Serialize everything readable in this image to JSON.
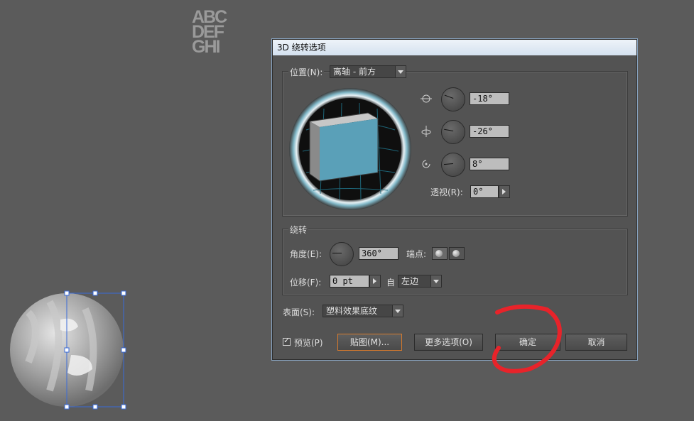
{
  "canvas": {
    "artwork_text_lines": [
      "ABC",
      "DEF",
      "GHI"
    ]
  },
  "dialog": {
    "title": "3D 绕转选项",
    "position": {
      "label": "位置(N):",
      "selected": "离轴 - 前方",
      "x_rotation": "-18°",
      "y_rotation": "-26°",
      "z_rotation": "8°",
      "perspective_label": "透视(R):",
      "perspective_value": "0°"
    },
    "revolve": {
      "section_label": "绕转",
      "angle_label": "角度(E):",
      "angle_value": "360°",
      "cap_label": "端点:",
      "offset_label": "位移(F):",
      "offset_value": "0 pt",
      "from_label": "自",
      "from_selected": "左边"
    },
    "surface": {
      "label": "表面(S):",
      "selected": "塑料效果底纹"
    },
    "buttons": {
      "preview_label": "预览(P)",
      "map_art": "贴图(M)...",
      "more_options": "更多选项(O)",
      "ok": "确定",
      "cancel": "取消"
    }
  },
  "colors": {
    "workspace": "#5b5b5b",
    "dialog_bg": "#535353",
    "cube_front": "#5aa0b8",
    "focus_border": "#d77a2c",
    "annotation_red": "#e8232a"
  }
}
